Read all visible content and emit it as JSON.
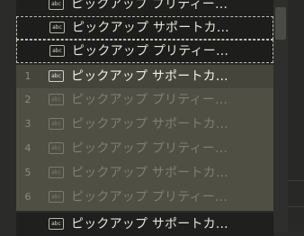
{
  "list": {
    "rows": [
      {
        "num": "",
        "icon": "abc",
        "label": "ピックアップ プリティー…",
        "style": "dark-top"
      },
      {
        "num": "",
        "icon": "abc",
        "label": "ピックアップ サポートカ...",
        "style": "dashed"
      },
      {
        "num": "",
        "icon": "abc",
        "label": "ピックアップ プリティー…",
        "style": "dashed"
      },
      {
        "num": "1",
        "icon": "abc",
        "label": "ピックアップ サポートカ...",
        "style": "active"
      },
      {
        "num": "2",
        "icon": "abc",
        "label": "ピックアップ プリティー…",
        "style": "dim"
      },
      {
        "num": "3",
        "icon": "abc",
        "label": "ピックアップ サポートカ...",
        "style": "dim"
      },
      {
        "num": "4",
        "icon": "abc",
        "label": "ピックアップ プリティー…",
        "style": "dim"
      },
      {
        "num": "5",
        "icon": "abc",
        "label": "ピックアップ サポートカ...",
        "style": "dim"
      },
      {
        "num": "6",
        "icon": "abc",
        "label": "ピックアップ プリティー…",
        "style": "dim"
      },
      {
        "num": "",
        "icon": "abc",
        "label": "ピックアップ サポートカ...",
        "style": "dark"
      }
    ]
  },
  "colors": {
    "background": "#2b2b29",
    "olive_highlight": "#4f4f43",
    "dark_row": "#1f1f1d"
  }
}
